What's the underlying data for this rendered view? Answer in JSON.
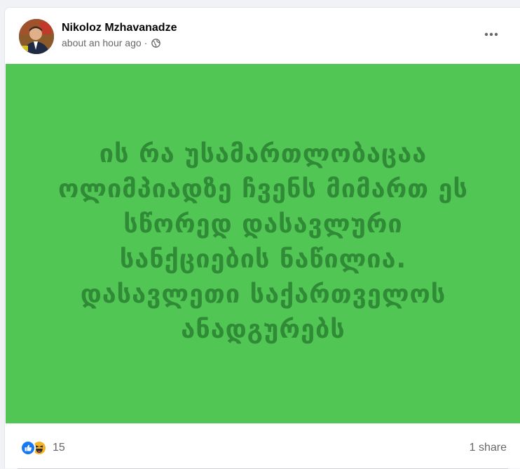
{
  "post": {
    "author": "Nikoloz Mzhavanadze",
    "time": "about an hour ago",
    "separator": "·",
    "privacy_icon": "globe-icon",
    "menu_icon": "more-horizontal-icon"
  },
  "banner": {
    "background_color": "#52c655",
    "text_color": "#2f8b35",
    "lines": [
      "ის რა უსამართლობაცაა",
      "ოლიმპიადზე ჩვენს მიმართ ეს",
      "სწორედ დასავლური",
      "სანქციების ნაწილია.",
      "დასავლეთი საქართველოს",
      "ანადგურებს"
    ]
  },
  "footer": {
    "reaction_icons": [
      "like-icon",
      "haha-icon"
    ],
    "reaction_count": "15",
    "shares": "1 share"
  }
}
